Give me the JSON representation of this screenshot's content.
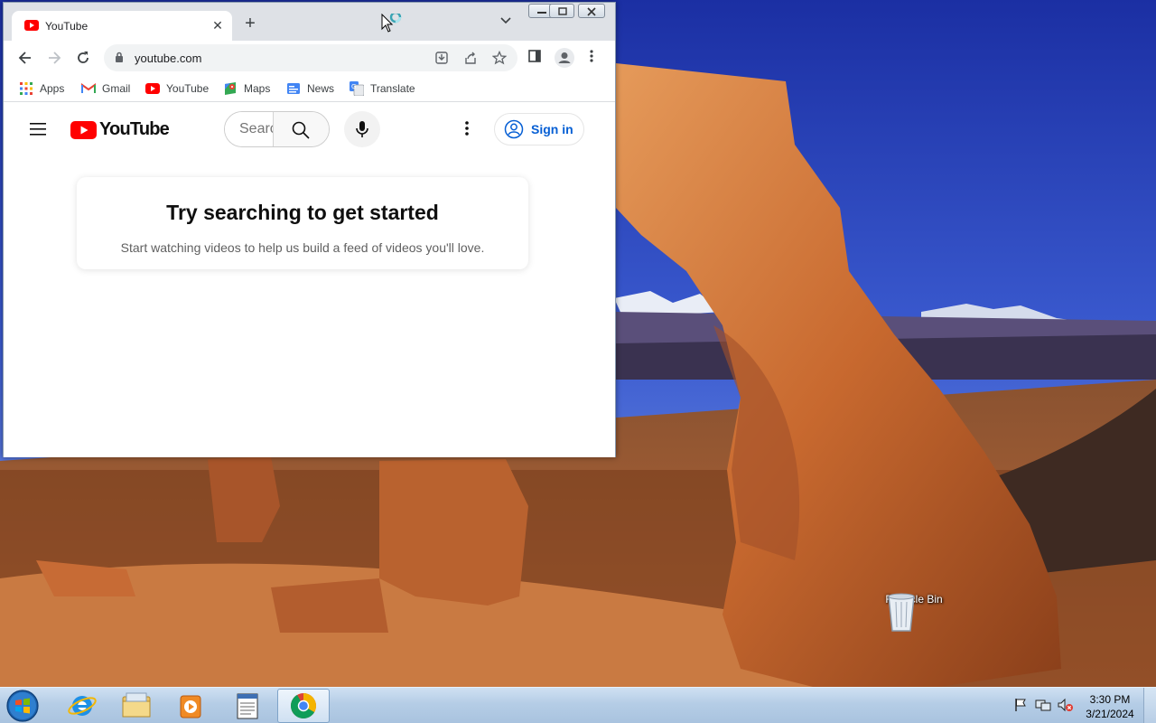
{
  "desktop": {
    "icons": [
      {
        "label": "Recycle Bin",
        "icon": "recycle-bin-icon"
      }
    ]
  },
  "browser": {
    "tab": {
      "title": "YouTube",
      "favicon": "youtube-favicon"
    },
    "address": {
      "url": "youtube.com"
    },
    "bookmarks": [
      {
        "label": "Apps",
        "icon": "apps-grid-icon"
      },
      {
        "label": "Gmail",
        "icon": "gmail-icon"
      },
      {
        "label": "YouTube",
        "icon": "youtube-favicon"
      },
      {
        "label": "Maps",
        "icon": "maps-icon"
      },
      {
        "label": "News",
        "icon": "news-icon"
      },
      {
        "label": "Translate",
        "icon": "translate-icon"
      }
    ]
  },
  "youtube": {
    "logo_text": "YouTube",
    "search_placeholder": "Search",
    "signin_label": "Sign in",
    "empty_title": "Try searching to get started",
    "empty_subtitle": "Start watching videos to help us build a feed of videos you'll love."
  },
  "taskbar": {
    "time": "3:30 PM",
    "date": "3/21/2024",
    "pinned": [
      "internet-explorer-icon",
      "file-explorer-icon",
      "media-player-icon",
      "notepad-icon",
      "chrome-icon"
    ]
  },
  "colors": {
    "youtube_red": "#ff0000",
    "signin_blue": "#065fd4",
    "taskbar": "#b5cde6"
  }
}
